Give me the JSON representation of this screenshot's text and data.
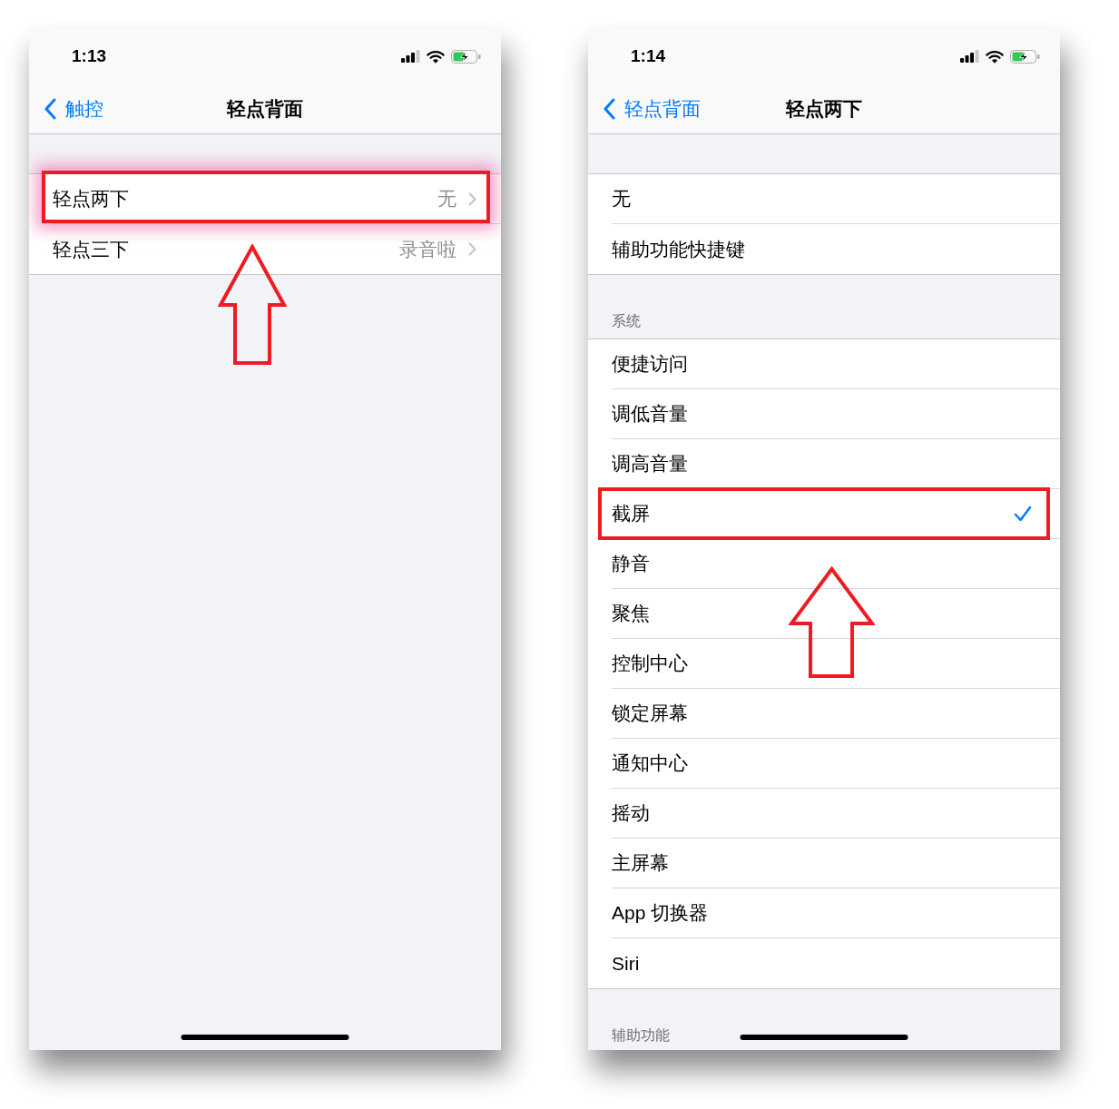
{
  "screens": [
    {
      "status_bar": {
        "time": "1:13"
      },
      "nav": {
        "back": "触控",
        "title": "轻点背面"
      },
      "sections": [
        {
          "rows": [
            {
              "kind": "disclosure",
              "label": "轻点两下",
              "value": "无",
              "highlighted": true
            },
            {
              "kind": "disclosure",
              "label": "轻点三下",
              "value": "录音啦",
              "highlighted": false
            }
          ]
        }
      ]
    },
    {
      "status_bar": {
        "time": "1:14"
      },
      "nav": {
        "back": "轻点背面",
        "title": "轻点两下"
      },
      "sections": [
        {
          "rows": [
            {
              "kind": "option",
              "label": "无",
              "selected": false,
              "highlighted": false
            },
            {
              "kind": "option",
              "label": "辅助功能快捷键",
              "selected": false,
              "highlighted": false
            }
          ]
        },
        {
          "header": "系统",
          "rows": [
            {
              "kind": "option",
              "label": "便捷访问",
              "selected": false,
              "highlighted": false
            },
            {
              "kind": "option",
              "label": "调低音量",
              "selected": false,
              "highlighted": false
            },
            {
              "kind": "option",
              "label": "调高音量",
              "selected": false,
              "highlighted": false
            },
            {
              "kind": "option",
              "label": "截屏",
              "selected": true,
              "highlighted": true
            },
            {
              "kind": "option",
              "label": "静音",
              "selected": false,
              "highlighted": false
            },
            {
              "kind": "option",
              "label": "聚焦",
              "selected": false,
              "highlighted": false
            },
            {
              "kind": "option",
              "label": "控制中心",
              "selected": false,
              "highlighted": false
            },
            {
              "kind": "option",
              "label": "锁定屏幕",
              "selected": false,
              "highlighted": false
            },
            {
              "kind": "option",
              "label": "通知中心",
              "selected": false,
              "highlighted": false
            },
            {
              "kind": "option",
              "label": "摇动",
              "selected": false,
              "highlighted": false
            },
            {
              "kind": "option",
              "label": "主屏幕",
              "selected": false,
              "highlighted": false
            },
            {
              "kind": "option",
              "label": "App 切换器",
              "selected": false,
              "highlighted": false
            },
            {
              "kind": "option",
              "label": "Siri",
              "selected": false,
              "highlighted": false
            }
          ]
        },
        {
          "header": "辅助功能"
        }
      ]
    }
  ]
}
